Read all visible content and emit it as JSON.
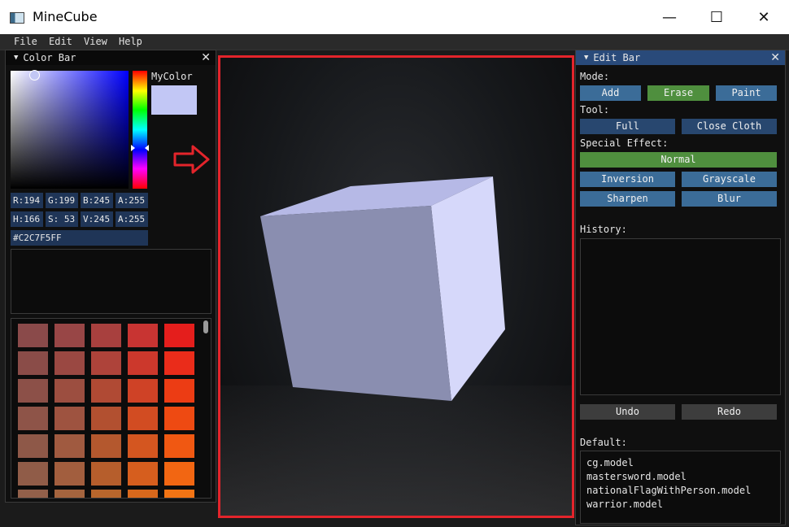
{
  "window": {
    "title": "MineCube",
    "minimize": "—",
    "maximize": "☐",
    "close": "✕"
  },
  "menu": {
    "items": [
      "File",
      "Edit",
      "View",
      "Help"
    ]
  },
  "color_bar": {
    "title": "Color Bar",
    "close": "✕",
    "mycolor_label": "MyColor",
    "mycolor_value": "#c2c7f5",
    "hue_fraction": 0.65,
    "rgba": [
      "R:194",
      "G:199",
      "B:245",
      "A:255"
    ],
    "hsva": [
      "H:166",
      "S: 53",
      "V:245",
      "A:255"
    ],
    "hex": "#C2C7F5FF",
    "palette_colors": [
      [
        "#8a4a4a",
        "#984646",
        "#a8403e",
        "#c83432",
        "#e41e1c"
      ],
      [
        "#8a4c48",
        "#9a4842",
        "#ae433a",
        "#cc382c",
        "#ea2c1a"
      ],
      [
        "#8c5048",
        "#9c4e40",
        "#b04a34",
        "#cf4226",
        "#ec3c14"
      ],
      [
        "#8e5448",
        "#9e5340",
        "#b25030",
        "#d24c22",
        "#ee4a12"
      ],
      [
        "#8e5848",
        "#a05a40",
        "#b4582e",
        "#d45620",
        "#f05812"
      ],
      [
        "#905c48",
        "#a25e3e",
        "#b65e2c",
        "#d65e1e",
        "#f26612"
      ],
      [
        "#92604a",
        "#a4643e",
        "#b8662c",
        "#d8681c",
        "#f27414"
      ]
    ]
  },
  "edit_bar": {
    "title": "Edit Bar",
    "close": "✕",
    "mode_label": "Mode:",
    "mode_buttons": [
      "Add",
      "Erase",
      "Paint"
    ],
    "tool_label": "Tool:",
    "tool_buttons": [
      "Full",
      "Close Cloth"
    ],
    "effect_label": "Special Effect:",
    "effect_normal": "Normal",
    "effect_buttons": [
      "Inversion",
      "Grayscale",
      "Sharpen",
      "Blur"
    ],
    "history_label": "History:",
    "undo": "Undo",
    "redo": "Redo",
    "default_label": "Default:",
    "default_models": [
      "cg.model",
      "mastersword.model",
      "nationalFlagWithPerson.model",
      "warrior.model"
    ]
  },
  "colors": {
    "accent_red": "#e3242b",
    "cube": "#c2c7f5",
    "header_active": "#294a7a",
    "button_blue": "#3b6c98",
    "button_green": "#4f8f3e"
  }
}
